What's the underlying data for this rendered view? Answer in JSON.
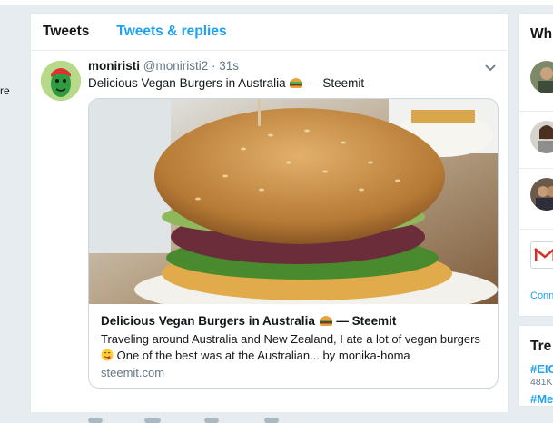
{
  "left_fragment": "re",
  "tabs": [
    {
      "label": "Tweets"
    },
    {
      "label": "Tweets & replies"
    }
  ],
  "tweet": {
    "name": "moniristi",
    "handle": "@moniristi2",
    "separator": "·",
    "time": "31s",
    "text": "Delicious Vegan Burgers in Australia",
    "text_suffix": "— Steemit",
    "avatar_icon": "green-character-avatar",
    "card": {
      "title": "Delicious Vegan Burgers in Australia",
      "title_suffix": "— Steemit",
      "description": "Traveling around Australia and New Zealand, I ate a lot of vegan burgers",
      "description_line2": "One of the best was at the Australian... by monika-homa",
      "domain": "steemit.com",
      "image_icon": "burger-photo"
    }
  },
  "who_to_follow": {
    "title": "Wh",
    "connect_label": "Conn"
  },
  "trends": {
    "title": "Tre",
    "items": [
      {
        "tag": "#EIC",
        "count": "481K"
      },
      {
        "tag": "#Me",
        "count": ""
      }
    ]
  },
  "colors": {
    "accent": "#1da1f2",
    "background": "#e6ecf0",
    "muted": "#657786"
  }
}
